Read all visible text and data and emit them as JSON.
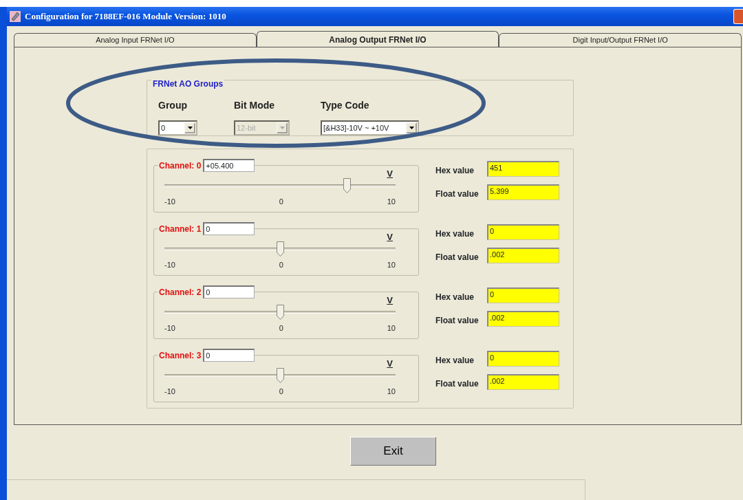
{
  "window": {
    "title": "Configuration for 7188EF-016 Module Version: 1010"
  },
  "tabs": [
    {
      "label": "Analog Input FRNet I/O",
      "selected": false
    },
    {
      "label": "Analog Output FRNet I/O",
      "selected": true
    },
    {
      "label": "Digit Input/Output FRNet I/O",
      "selected": false
    }
  ],
  "ao_groups": {
    "title": "FRNet AO Groups",
    "fields": [
      {
        "label": "Group",
        "value": "0",
        "disabled": false
      },
      {
        "label": "Bit Mode",
        "value": "12-bit",
        "disabled": true
      },
      {
        "label": "Type Code",
        "value": "[&H33]-10V ~ +10V",
        "disabled": false
      }
    ]
  },
  "highlight_oval": true,
  "channels": [
    {
      "label": "Channel: 0",
      "value": "+05.400",
      "unit": "V",
      "level": 0.79,
      "scale": [
        "-10",
        "0",
        "10"
      ],
      "hex_label": "Hex value",
      "hex": "451",
      "float_label": "Float value",
      "float": "5.399"
    },
    {
      "label": "Channel: 1",
      "value": "0",
      "unit": "V",
      "level": 0.5,
      "scale": [
        "-10",
        "0",
        "10"
      ],
      "hex_label": "Hex value",
      "hex": "0",
      "float_label": "Float value",
      "float": ".002"
    },
    {
      "label": "Channel: 2",
      "value": "0",
      "unit": "V",
      "level": 0.5,
      "scale": [
        "-10",
        "0",
        "10"
      ],
      "hex_label": "Hex value",
      "hex": "0",
      "float_label": "Float value",
      "float": ".002"
    },
    {
      "label": "Channel: 3",
      "value": "0",
      "unit": "V",
      "level": 0.5,
      "scale": [
        "-10",
        "0",
        "10"
      ],
      "hex_label": "Hex value",
      "hex": "0",
      "float_label": "Float value",
      "float": ".002"
    }
  ],
  "exit_button": "Exit"
}
